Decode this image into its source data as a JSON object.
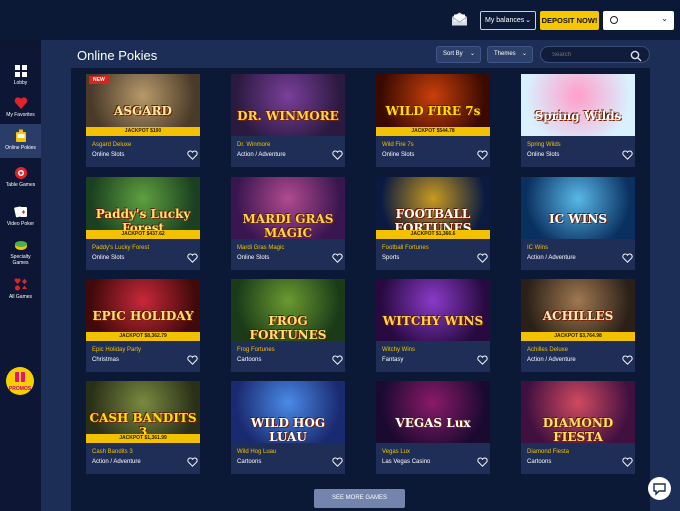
{
  "header": {
    "balances_label": "My balances",
    "deposit_label": "DEPOSIT NOW!",
    "colors": {
      "deposit": "#f6c700",
      "background": "#0b1836"
    }
  },
  "sidebar": {
    "items": [
      {
        "label": "Lobby",
        "icon": "lobby-icon"
      },
      {
        "label": "My Favorites",
        "icon": "heart-icon"
      },
      {
        "label": "Online Pokies",
        "icon": "pokies-icon",
        "active": true
      },
      {
        "label": "Table Games",
        "icon": "chip-icon"
      },
      {
        "label": "Video Poker",
        "icon": "cards-icon"
      },
      {
        "label": "Specialty Games",
        "icon": "specialty-icon"
      },
      {
        "label": "All Games",
        "icon": "suits-icon"
      }
    ],
    "promo_label": "PROMOS"
  },
  "main": {
    "title": "Online Pokies",
    "sort_label": "Sort By",
    "themes_label": "Themes",
    "search_placeholder": "Search",
    "more_label": "SEE MORE GAMES"
  },
  "games": [
    {
      "name": "Asgard Deluxe",
      "category": "Online Slots",
      "jackpot": "JACKPOT $100",
      "badge": "NEW",
      "logo": "ASGARD"
    },
    {
      "name": "Dr. Winmore",
      "category": "Action / Adventure",
      "logo": "DR. WINMORE"
    },
    {
      "name": "Wild Fire 7s",
      "category": "Online Slots",
      "jackpot": "JACKPOT $544.78",
      "logo": "WILD FIRE 7s"
    },
    {
      "name": "Spring Wilds",
      "category": "Online Slots",
      "logo": "Spring Wilds"
    },
    {
      "name": "Paddy's Lucky Forest",
      "category": "Online Slots",
      "jackpot": "JACKPOT $437.62",
      "logo": "Paddy's Lucky Forest"
    },
    {
      "name": "Mardi Gras Magic",
      "category": "Online Slots",
      "logo": "MARDI GRAS MAGIC"
    },
    {
      "name": "Football Fortunes",
      "category": "Sports",
      "jackpot": "JACKPOT $1,366.6",
      "logo": "FOOTBALL FORTUNES"
    },
    {
      "name": "IC Wins",
      "category": "Action / Adventure",
      "logo": "IC WINS"
    },
    {
      "name": "Epic Holiday Party",
      "category": "Christmas",
      "jackpot": "JACKPOT $8,362.79",
      "logo": "EPIC HOLIDAY"
    },
    {
      "name": "Frog Fortunes",
      "category": "Cartoons",
      "logo": "FROG FORTUNES"
    },
    {
      "name": "Witchy Wins",
      "category": "Fantasy",
      "logo": "WITCHY WINS"
    },
    {
      "name": "Achilles Deluxe",
      "category": "Action / Adventure",
      "jackpot": "JACKPOT $3,764.98",
      "logo": "ACHILLES"
    },
    {
      "name": "Cash Bandits 3",
      "category": "Action / Adventure",
      "jackpot": "JACKPOT $1,361.99",
      "logo": "CASH BANDITS 3"
    },
    {
      "name": "Wild Hog Luau",
      "category": "Cartoons",
      "logo": "WILD HOG LUAU"
    },
    {
      "name": "Vegas Lux",
      "category": "Las Vegas Casino",
      "logo": "VEGAS Lux"
    },
    {
      "name": "Diamond Fiesta",
      "category": "Cartoons",
      "logo": "DIAMOND FIESTA"
    }
  ]
}
